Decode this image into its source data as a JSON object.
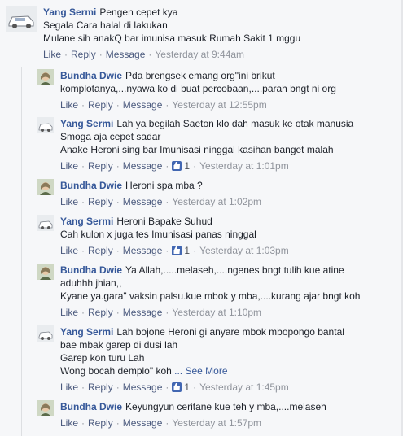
{
  "actions": {
    "like": "Like",
    "reply": "Reply",
    "message": "Message",
    "separator": "·",
    "like_icon": "thumbs-up-icon"
  },
  "comments": [
    {
      "author": "Yang Sermi",
      "avatar": "car-avatar",
      "lines": [
        "Pengen cepet kya",
        "Segala Cara halal di lakukan",
        "Mulane sih anakQ bar imunisa masuk Rumah Sakit 1 mggu"
      ],
      "likes": "",
      "time": "Yesterday at 9:44am"
    },
    {
      "author": "Bundha Dwie",
      "avatar": "woman-avatar",
      "lines": [
        "Pda brengsek emang org\"ini brikut",
        "komplotanya,...nyawa ko di buat percobaan,....parah bngt ni org"
      ],
      "likes": "",
      "time": "Yesterday at 12:55pm"
    },
    {
      "author": "Yang Sermi",
      "avatar": "car-avatar",
      "lines": [
        "Lah ya begilah Saeton klo dah masuk ke otak manusia",
        "Smoga aja cepet sadar",
        "Anake Heroni sing bar Imunisasi ninggal kasihan banget malah"
      ],
      "likes": "1",
      "time": "Yesterday at 1:01pm"
    },
    {
      "author": "Bundha Dwie",
      "avatar": "woman-avatar",
      "lines": [
        "Heroni spa mba ?"
      ],
      "likes": "",
      "time": "Yesterday at 1:02pm"
    },
    {
      "author": "Yang Sermi",
      "avatar": "car-avatar",
      "lines": [
        "Heroni Bapake Suhud",
        "Cah kulon x juga tes Imunisasi panas ninggal"
      ],
      "likes": "1",
      "time": "Yesterday at 1:03pm"
    },
    {
      "author": "Bundha Dwie",
      "avatar": "woman-avatar",
      "lines": [
        "Ya Allah,.....melaseh,....ngenes bngt tulih kue atine",
        "aduhhh jhian,,",
        "Kyane ya.gara\" vaksin palsu.kue mbok y mba,....kurang ajar bngt koh"
      ],
      "likes": "",
      "time": "Yesterday at 1:10pm"
    },
    {
      "author": "Yang Sermi",
      "avatar": "car-avatar",
      "lines": [
        "Lah bojone Heroni gi anyare mbok mbopongo bantal",
        "bae mbak garep di dusi lah",
        "Garep kon turu Lah",
        "Wong bocah demplo\" koh"
      ],
      "see_more": "... See More",
      "likes": "1",
      "time": "Yesterday at 1:45pm"
    },
    {
      "author": "Bundha Dwie",
      "avatar": "woman-avatar",
      "lines": [
        "Keyungyun ceritane kue teh y mba,....melaseh"
      ],
      "likes": "",
      "time": "Yesterday at 1:57pm"
    }
  ]
}
